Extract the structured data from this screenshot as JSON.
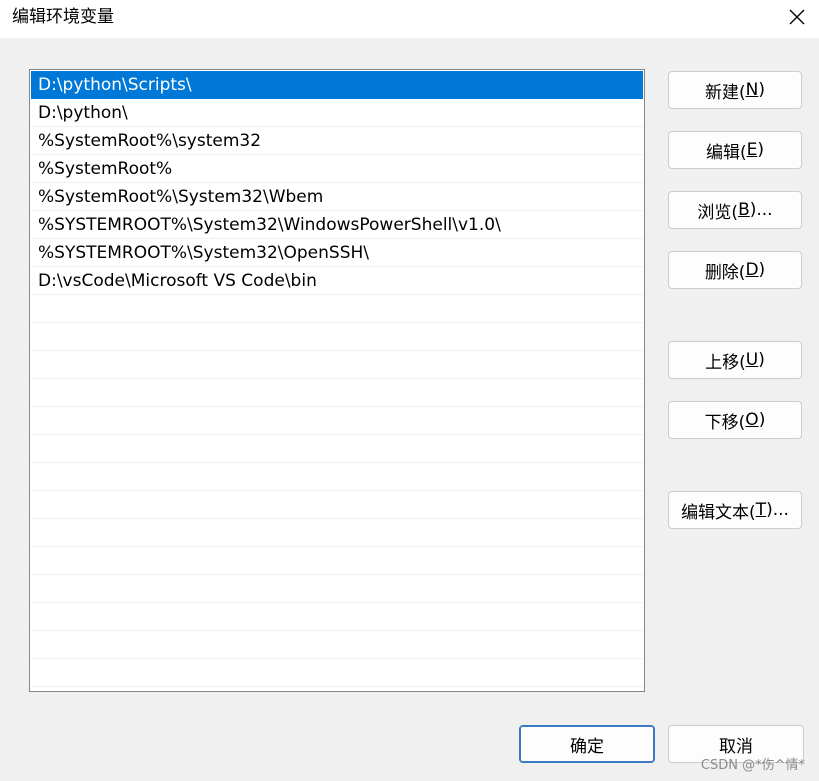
{
  "window": {
    "title": "编辑环境变量",
    "close_icon": "close-icon"
  },
  "path_list": {
    "selected_index": 0,
    "items": [
      "D:\\python\\Scripts\\",
      "D:\\python\\",
      "%SystemRoot%\\system32",
      "%SystemRoot%",
      "%SystemRoot%\\System32\\Wbem",
      "%SYSTEMROOT%\\System32\\WindowsPowerShell\\v1.0\\",
      "%SYSTEMROOT%\\System32\\OpenSSH\\",
      "D:\\vsCode\\Microsoft VS Code\\bin"
    ]
  },
  "buttons": {
    "new": {
      "text": "新建(",
      "key": "N",
      "tail": ")"
    },
    "edit": {
      "text": "编辑(",
      "key": "E",
      "tail": ")"
    },
    "browse": {
      "text": "浏览(",
      "key": "B",
      "tail": ")..."
    },
    "delete": {
      "text": "删除(",
      "key": "D",
      "tail": ")"
    },
    "move_up": {
      "text": "上移(",
      "key": "U",
      "tail": ")"
    },
    "move_down": {
      "text": "下移(",
      "key": "O",
      "tail": ")"
    },
    "edit_text": {
      "text": "编辑文本(",
      "key": "T",
      "tail": ")..."
    },
    "ok": "确定",
    "cancel": "取消"
  },
  "colors": {
    "selection": "#0078d7",
    "window_bg": "#f0f0f0",
    "primary_border": "#3b79c4"
  },
  "watermark": "CSDN @*伤^情*"
}
